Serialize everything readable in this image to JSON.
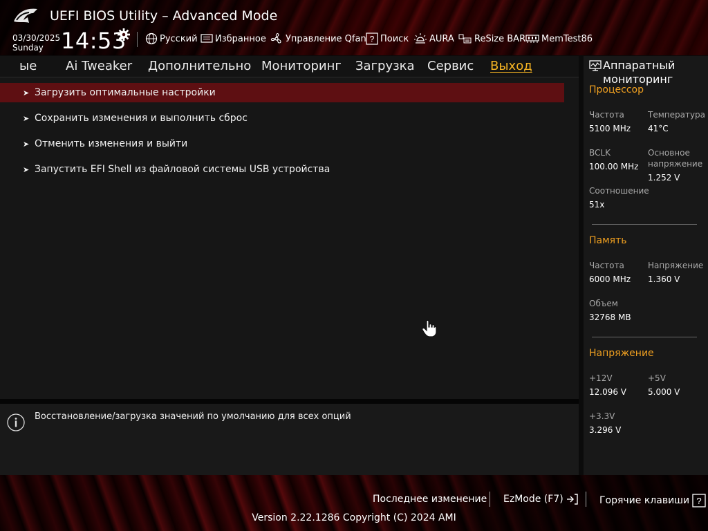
{
  "header": {
    "title": "UEFI BIOS Utility – Advanced Mode",
    "date": "03/30/2025",
    "day": "Sunday",
    "time": "14:53",
    "tools": [
      {
        "label": "Русский",
        "icon": "globe-icon"
      },
      {
        "label": "Избранное",
        "icon": "favorites-icon"
      },
      {
        "label": "Управление Qfan",
        "icon": "fan-icon"
      },
      {
        "label": "Поиск",
        "icon": "help-search-icon"
      },
      {
        "label": "AURA",
        "icon": "aura-light-icon"
      },
      {
        "label": "ReSize BAR",
        "icon": "resize-bar-icon"
      },
      {
        "label": "MemTest86",
        "icon": "memory-icon"
      }
    ]
  },
  "menu": {
    "items": [
      "ые",
      "Ai Tweaker",
      "Дополнительно",
      "Мониторинг",
      "Загрузка",
      "Сервис",
      "Выход"
    ],
    "active_index": 6
  },
  "main": {
    "options": [
      "Загрузить оптимальные настройки",
      "Сохранить изменения и выполнить сброс",
      "Отменить изменения и выйти",
      "Запустить EFI Shell из файловой системы USB устройства"
    ],
    "selected_index": 0,
    "arrow": "➤"
  },
  "help": {
    "text": "Восстановление/загрузка значений по умолчанию для всех опций"
  },
  "monitor": {
    "title_line1": "Аппаратный",
    "title_line2": "мониторинг",
    "cpu": {
      "title": "Процессор",
      "freq_label": "Частота",
      "freq": "5100 MHz",
      "temp_label": "Температура",
      "temp": "41°C",
      "bclk_label": "BCLK",
      "bclk": "100.00 MHz",
      "core_v_label1": "Основное",
      "core_v_label2": "напряжение",
      "core_v": "1.252 V",
      "ratio_label": "Соотношение",
      "ratio": "51x"
    },
    "memory": {
      "title": "Память",
      "freq_label": "Частота",
      "freq": "6000 MHz",
      "volt_label": "Напряжение",
      "volt": "1.360 V",
      "size_label": "Объем",
      "size": "32768 MB"
    },
    "voltage": {
      "title": "Напряжение",
      "v12_label": "+12V",
      "v12": "12.096 V",
      "v5_label": "+5V",
      "v5": "5.000 V",
      "v33_label": "+3.3V",
      "v33": "3.296 V"
    }
  },
  "footer": {
    "last_change": "Последнее изменение",
    "ezmode": "EzMode (F7)",
    "hotkeys": "Горячие клавиши",
    "version": "Version 2.22.1286 Copyright (C) 2024 AMI"
  },
  "colors": {
    "accent": "#f5b323",
    "section_title": "#f0a020",
    "selection": "#5e0f12"
  }
}
